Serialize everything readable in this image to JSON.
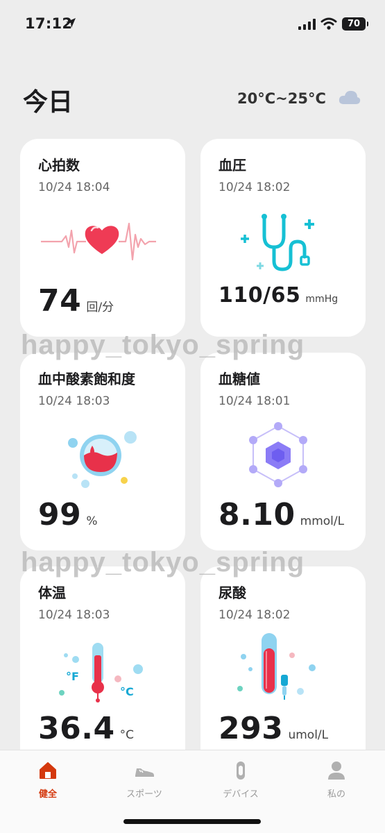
{
  "status_bar": {
    "time": "17:12",
    "battery": "70"
  },
  "header": {
    "title": "今日",
    "weather": "20°C~25°C"
  },
  "cards": [
    {
      "title": "心拍数",
      "time": "10/24 18:04",
      "value": "74",
      "unit": "回/分"
    },
    {
      "title": "血圧",
      "time": "10/24 18:02",
      "value": "110/65",
      "unit": "mmHg"
    },
    {
      "title": "血中酸素飽和度",
      "time": "10/24 18:03",
      "value": "99",
      "unit": "%"
    },
    {
      "title": "血糖値",
      "time": "10/24 18:01",
      "value": "8.10",
      "unit": "mmol/L"
    },
    {
      "title": "体温",
      "time": "10/24 18:03",
      "value": "36.4",
      "unit": "°C"
    },
    {
      "title": "尿酸",
      "time": "10/24 18:02",
      "value": "293",
      "unit": "umol/L"
    }
  ],
  "illustration_labels": {
    "fahrenheit": "°F",
    "celsius": "°C"
  },
  "watermark": "happy_tokyo_spring",
  "tabs": [
    {
      "label": "健全",
      "icon": "home-icon",
      "active": true
    },
    {
      "label": "スポーツ",
      "icon": "shoe-icon",
      "active": false
    },
    {
      "label": "デバイス",
      "icon": "band-icon",
      "active": false
    },
    {
      "label": "私の",
      "icon": "person-icon",
      "active": false
    }
  ],
  "colors": {
    "accent": "#d4380d",
    "heart": "#ef3b55",
    "teal": "#16c0d4",
    "purple": "#8b7cf6"
  }
}
